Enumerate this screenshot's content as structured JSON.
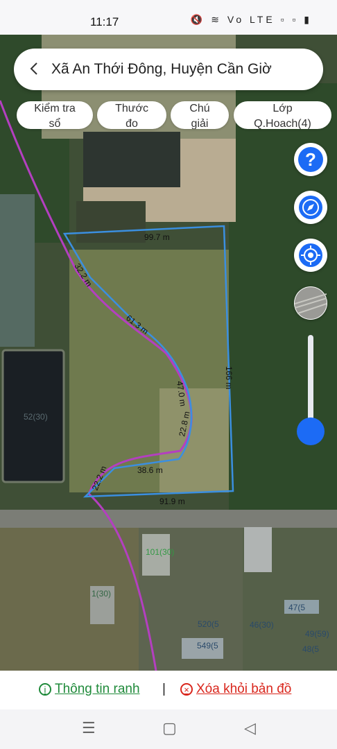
{
  "status_bar": {
    "time": "11:17",
    "icons_text": "🔇 ≋ Vo LTE ▫ ▫ ▮"
  },
  "search": {
    "title": "Xã An Thới Đông, Huyện Cần Giờ"
  },
  "chips": [
    {
      "line1": "Kiểm tra",
      "line2": "sổ"
    },
    {
      "line1": "Thước",
      "line2": "đo"
    },
    {
      "line1": "Chú",
      "line2": "giải"
    },
    {
      "line1": "Lớp",
      "line2": "Q.Hoach(4)"
    }
  ],
  "side_buttons": [
    "help-icon",
    "compass-icon",
    "my-location-icon",
    "layers-icon"
  ],
  "help_symbol": "?",
  "map_labels": {
    "top_edge": "99.7 m",
    "left_top": "32.2 m",
    "left_mid": "61.3 m",
    "curve_a": "47.0 m",
    "curve_b": "22.8 m",
    "inner_bottom": "38.6 m",
    "left_bottom": "22.2 m",
    "bottom_edge": "91.9 m",
    "right_edge": "166 m",
    "parcel_a": "52(30)",
    "parcel_b": "101(30)",
    "parcel_c": "1(30)",
    "parcel_d": "46(30)",
    "parcel_e": "47(5",
    "parcel_f": "520(5",
    "parcel_g": "549(5",
    "parcel_h": "48(5",
    "parcel_i": "49(59)"
  },
  "bottom_bar": {
    "info_label": "Thông tin ranh",
    "separator": "|",
    "delete_label": "Xóa khỏi bản đồ"
  },
  "colors": {
    "boundary": "#3b8fe0",
    "route": "#b43fc0",
    "accent": "#1c6bf5",
    "info": "#1f8a3a",
    "delete": "#d9261c"
  }
}
